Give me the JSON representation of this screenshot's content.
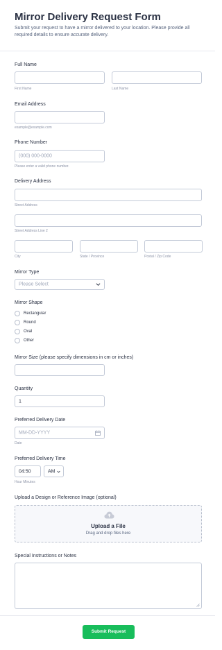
{
  "header": {
    "title": "Mirror Delivery Request Form",
    "subtitle": "Submit your request to have a mirror delivered to your location. Please provide all required details to ensure accurate delivery."
  },
  "full_name": {
    "label": "Full Name",
    "first_sub": "First Name",
    "last_sub": "Last Name",
    "first_value": "",
    "last_value": ""
  },
  "email": {
    "label": "Email Address",
    "sub": "example@example.com",
    "value": ""
  },
  "phone": {
    "label": "Phone Number",
    "placeholder": "(000) 000-0000",
    "sub": "Please enter a valid phone number."
  },
  "address": {
    "label": "Delivery Address",
    "street_sub": "Street Address",
    "street2_sub": "Street Address Line 2",
    "city_sub": "City",
    "state_sub": "State / Province",
    "zip_sub": "Postal / Zip Code"
  },
  "mirror_type": {
    "label": "Mirror Type",
    "placeholder": "Please Select"
  },
  "mirror_shape": {
    "label": "Mirror Shape",
    "options": [
      "Rectangular",
      "Round",
      "Oval",
      "Other"
    ]
  },
  "mirror_size": {
    "label": "Mirror Size (please specify dimensions in cm or inches)",
    "value": ""
  },
  "quantity": {
    "label": "Quantity",
    "value": "1"
  },
  "delivery_date": {
    "label": "Preferred Delivery Date",
    "placeholder": "MM-DD-YYYY",
    "sub": "Date"
  },
  "delivery_time": {
    "label": "Preferred Delivery Time",
    "time_value": "04:50",
    "ampm_value": "AM",
    "sub": "Hour Minutes"
  },
  "upload": {
    "label": "Upload a Design or Reference Image (optional)",
    "title": "Upload a File",
    "hint": "Drag and drop files here"
  },
  "notes": {
    "label": "Special Instructions or Notes",
    "value": ""
  },
  "submit": {
    "label": "Submit Request"
  },
  "colors": {
    "accent": "#18bd5b",
    "text": "#2c3345",
    "border": "#c3cad8",
    "muted": "#8d94a8"
  }
}
